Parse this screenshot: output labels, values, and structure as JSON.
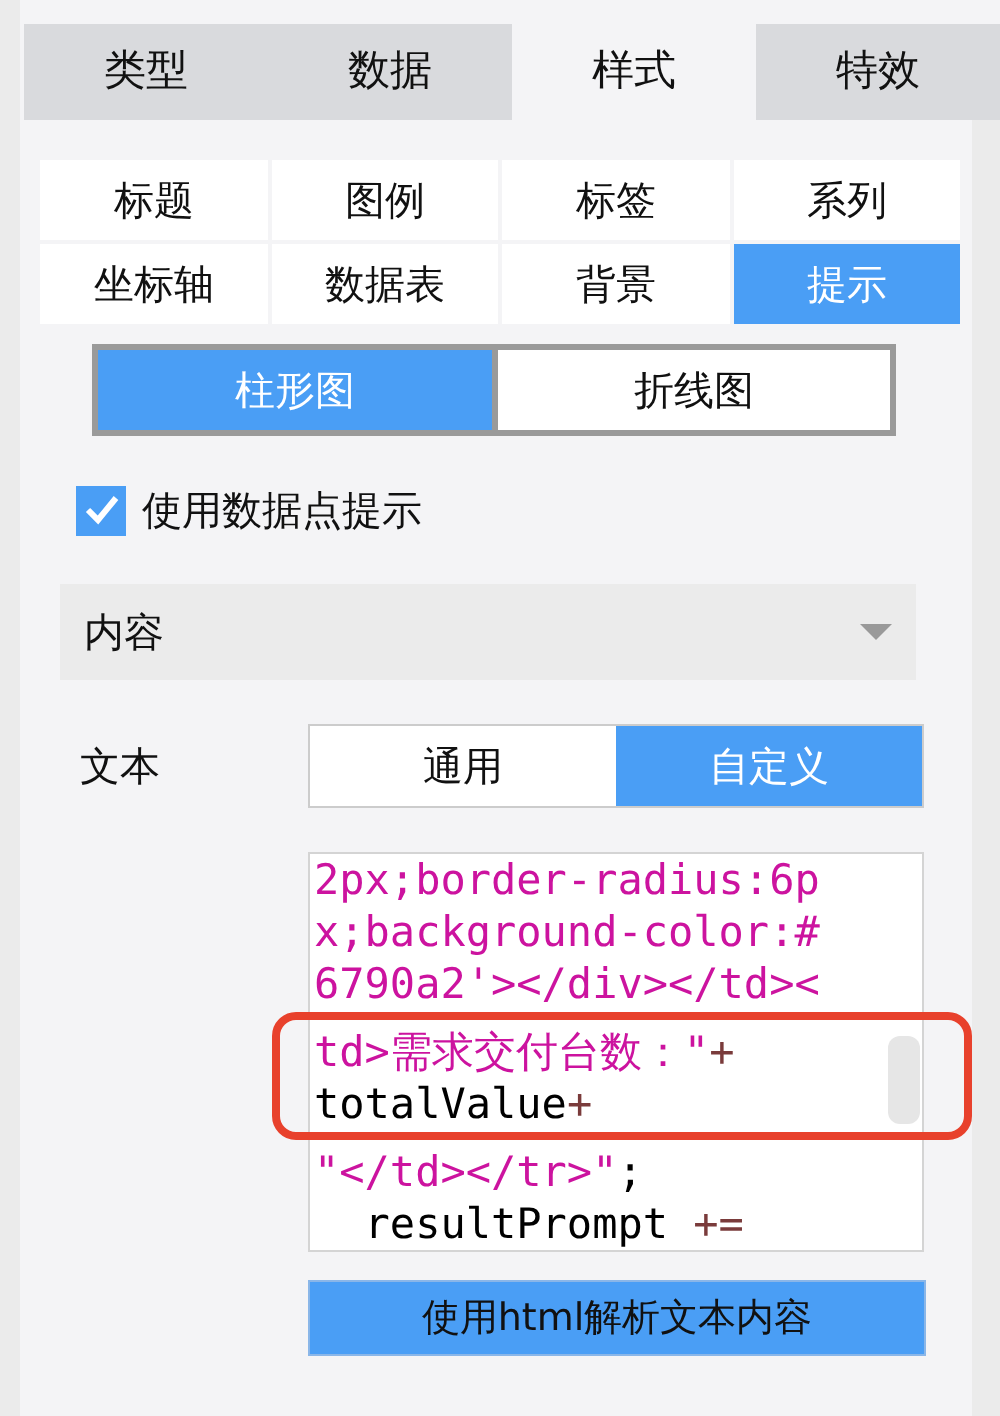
{
  "main_tabs": [
    {
      "label": "类型",
      "selected": false
    },
    {
      "label": "数据",
      "selected": false
    },
    {
      "label": "样式",
      "selected": true
    },
    {
      "label": "特效",
      "selected": false
    }
  ],
  "sub_tabs": [
    {
      "label": "标题",
      "selected": false
    },
    {
      "label": "图例",
      "selected": false
    },
    {
      "label": "标签",
      "selected": false
    },
    {
      "label": "系列",
      "selected": false
    },
    {
      "label": "坐标轴",
      "selected": false
    },
    {
      "label": "数据表",
      "selected": false
    },
    {
      "label": "背景",
      "selected": false
    },
    {
      "label": "提示",
      "selected": true
    }
  ],
  "chart_types": [
    {
      "label": "柱形图",
      "selected": true
    },
    {
      "label": "折线图",
      "selected": false
    }
  ],
  "tooltip_checkbox": {
    "label": "使用数据点提示",
    "checked": true
  },
  "section": {
    "title": "内容"
  },
  "text_mode": {
    "label": "文本",
    "options": [
      {
        "label": "通用",
        "selected": false
      },
      {
        "label": "自定义",
        "selected": true
      }
    ]
  },
  "code_lines": [
    [
      {
        "kind": "string",
        "text": "2px;border-radius:6p"
      }
    ],
    [
      {
        "kind": "string",
        "text": "x;background-color:#"
      }
    ],
    [
      {
        "kind": "string",
        "text": "6790a2'></div></td><"
      }
    ],
    [
      {
        "kind": "string",
        "text": "td>需求交付台数：\""
      },
      {
        "kind": "operator",
        "text": "+"
      }
    ],
    [
      {
        "kind": "plain",
        "text": "totalValue"
      },
      {
        "kind": "operator",
        "text": "+"
      }
    ],
    [
      {
        "kind": "string",
        "text": "\"</td></tr>\""
      },
      {
        "kind": "plain",
        "text": ";"
      }
    ],
    [
      {
        "kind": "plain",
        "text": "  resultPrompt "
      },
      {
        "kind": "operator",
        "text": "+="
      }
    ]
  ],
  "parse_button": {
    "label": "使用html解析文本内容"
  }
}
